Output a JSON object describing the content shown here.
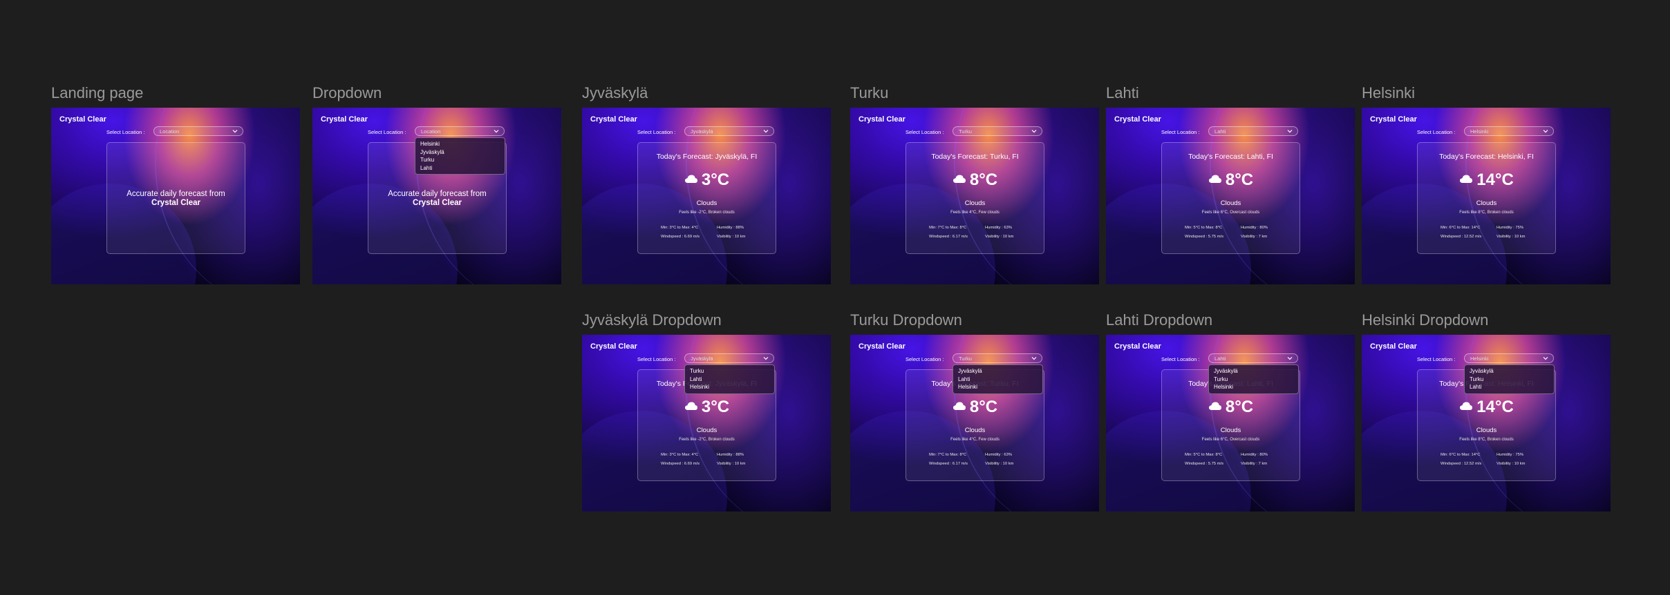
{
  "app_title": "Crystal Clear",
  "select_label": "Select Location :",
  "placeholder": "Location",
  "landing_message": "Accurate daily forecast from",
  "landing_brand": "Crystal Clear",
  "colors": {
    "canvas": "#1e1e1e",
    "frame_title": "#9a9a9a",
    "accent_purple": "#4a16e6",
    "accent_orange": "#f59046"
  },
  "frames": {
    "landing": {
      "title": "Landing page"
    },
    "dropdown": {
      "title": "Dropdown",
      "options": [
        "Helsinki",
        "Jyväskylä",
        "Turku",
        "Lahti"
      ]
    },
    "jyvaskyla": {
      "title": "Jyväskylä",
      "selected": "Jyväskylä",
      "forecast_title": "Today's Forecast: Jyväskylä, FI",
      "temp": "3°C",
      "condition": "Clouds",
      "feels": "Feels like -2°C, Broken clouds",
      "minmax": "Min: 3°C to Max: 4°C",
      "humidity": "Humidity : 88%",
      "wind": "Windspeed : 6.69 m/s",
      "visibility": "Visibility : 10 km"
    },
    "turku": {
      "title": "Turku",
      "selected": "Turku",
      "forecast_title": "Today's Forecast: Turku, FI",
      "temp": "8°C",
      "condition": "Clouds",
      "feels": "Feels like 4°C, Few clouds",
      "minmax": "Min: 7°C to Max: 8°C",
      "humidity": "Humidity : 63%",
      "wind": "Windspeed : 6.17 m/s",
      "visibility": "Visibility : 10 km"
    },
    "lahti": {
      "title": "Lahti",
      "selected": "Lahti",
      "forecast_title": "Today's Forecast: Lahti, FI",
      "temp": "8°C",
      "condition": "Clouds",
      "feels": "Feels like 6°C, Overcast clouds",
      "minmax": "Min: 5°C to Max: 8°C",
      "humidity": "Humidity : 80%",
      "wind": "Windspeed : 5.75 m/s",
      "visibility": "Visibility : 7 km"
    },
    "helsinki": {
      "title": "Helsinki",
      "selected": "Helsinki",
      "forecast_title": "Today's Forecast: Helsinki, FI",
      "temp": "14°C",
      "condition": "Clouds",
      "feels": "Feels like 8°C, Broken clouds",
      "minmax": "Min: 6°C to Max: 14°C",
      "humidity": "Humidity : 75%",
      "wind": "Windspeed : 12.52 m/s",
      "visibility": "Visibility : 10 km"
    },
    "jyvaskyla_dd": {
      "title": "Jyväskylä Dropdown",
      "options": [
        "Turku",
        "Lahti",
        "Helsinki"
      ]
    },
    "turku_dd": {
      "title": "Turku Dropdown",
      "options": [
        "Jyväskylä",
        "Lahti",
        "Helsinki"
      ]
    },
    "lahti_dd": {
      "title": "Lahti Dropdown",
      "options": [
        "Jyväskylä",
        "Turku",
        "Helsinki"
      ]
    },
    "helsinki_dd": {
      "title": "Helsinki Dropdown",
      "options": [
        "Jyväskylä",
        "Turku",
        "Lahti"
      ]
    }
  }
}
